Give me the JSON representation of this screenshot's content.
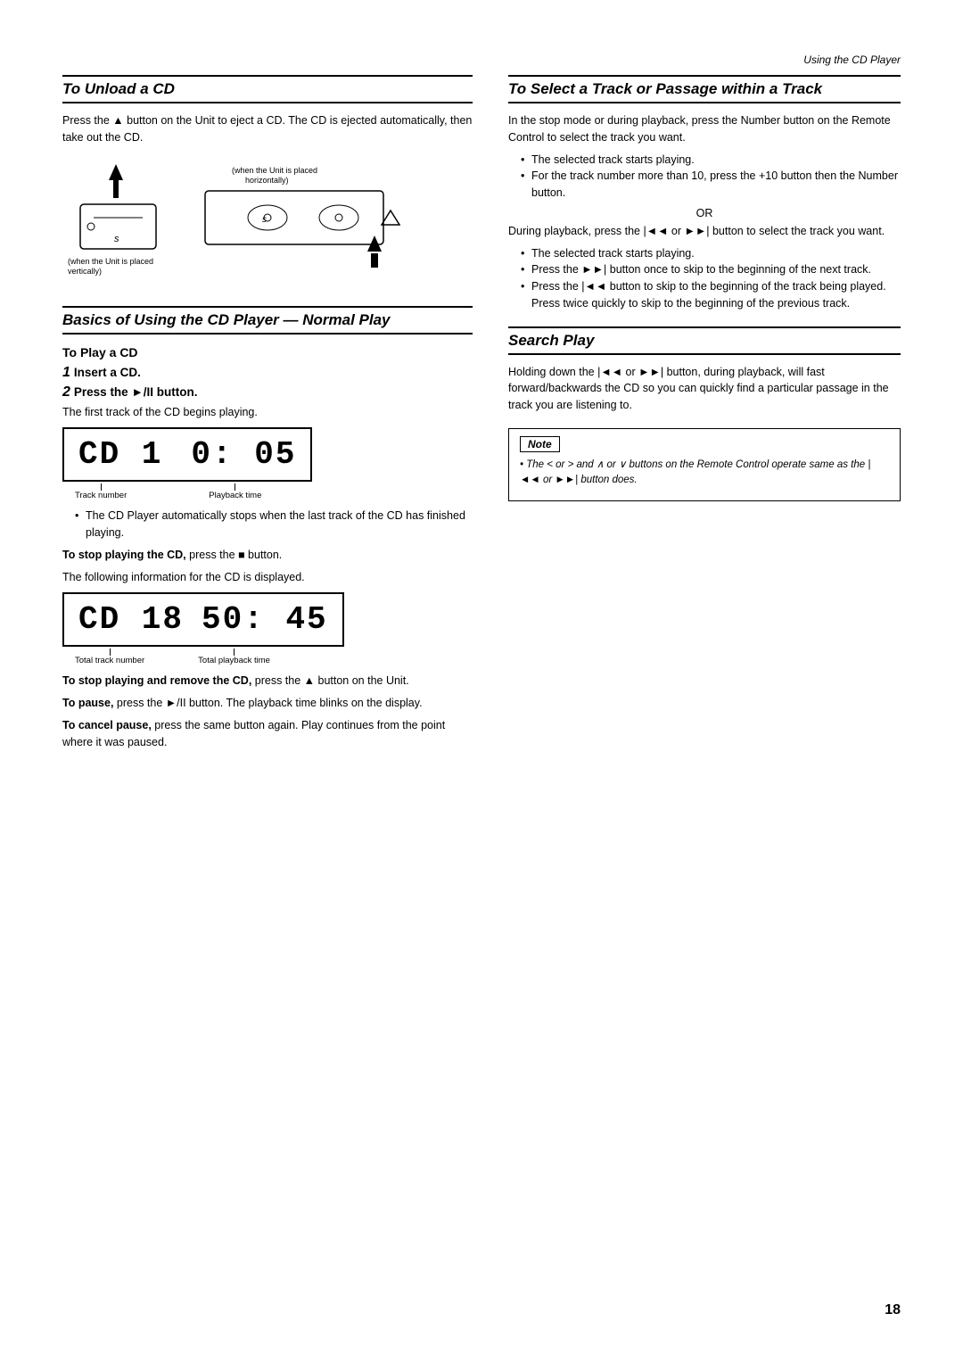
{
  "header": {
    "right_text": "Using the CD Player"
  },
  "left_col": {
    "section1": {
      "title": "To Unload a CD",
      "body": "Press the ▲ button on the Unit to eject a CD. The CD is ejected automatically, then take out the CD.",
      "diagram_labels": {
        "label1": "(when the Unit is placed horizontally)",
        "label2": "(when the Unit is placed vertically)"
      }
    },
    "section2": {
      "title": "Basics of Using the CD Player — Normal Play",
      "subsection": "To Play a CD",
      "step1_num": "1",
      "step1_label": "Insert a CD.",
      "step2_num": "2",
      "step2_label": "Press the ►/II button.",
      "step2_body": "The first track of the CD begins playing.",
      "display1": {
        "left": "CD  1",
        "right": "0: 05",
        "label_left": "Track number",
        "label_right": "Playback time"
      },
      "bullet1": "The CD Player automatically stops when the last track of the CD has finished playing.",
      "stop_bold": "To stop playing the CD,",
      "stop_body": " press the ■ button.",
      "stop_body2": "The following information for the CD is displayed.",
      "display2": {
        "left": "CD  18",
        "right": "50: 45",
        "label_left": "Total track number",
        "label_right": "Total playback time"
      },
      "stop_playing_bold": "To stop playing and remove the CD,",
      "stop_playing_body": " press the ▲ button on the Unit.",
      "pause_bold": "To pause,",
      "pause_body": " press the ►/II button. The playback time blinks on the display.",
      "cancel_bold": "To cancel pause,",
      "cancel_body": " press the same button again. Play continues from the point where it was paused."
    }
  },
  "right_col": {
    "section3": {
      "title": "To Select a Track or Passage within a Track",
      "body": "In the stop mode or during playback, press the Number button on the Remote Control to select the track you want.",
      "bullets": [
        "The selected track starts playing.",
        "For the track number more than 10, press the +10 button then the Number button."
      ],
      "or_text": "OR",
      "body2": "During playback, press the |◄◄ or ►►| button to select the track you want.",
      "bullets2": [
        "The selected track starts playing.",
        "Press the ►►| button once to skip to the beginning of the next track.",
        "Press the |◄◄ button to skip to the beginning of the track being played. Press twice quickly to skip to the beginning of the previous track."
      ]
    },
    "section4": {
      "title": "Search Play",
      "body": "Holding down the |◄◄ or ►►| button, during playback, will fast forward/backwards the CD so you can quickly find a particular passage in the track you are listening to."
    },
    "note": {
      "title": "Note",
      "body": "• The < or > and ∧ or ∨ buttons on the Remote Control operate same as the |◄◄ or ►►| button does."
    }
  },
  "page_number": "18"
}
